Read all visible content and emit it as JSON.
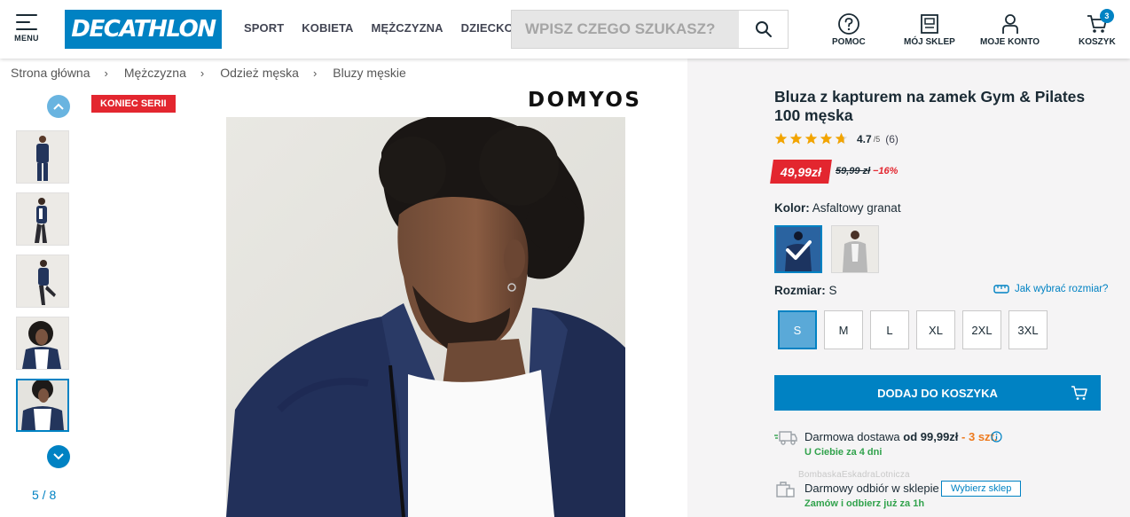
{
  "header": {
    "menu_label": "MENU",
    "logo_text": "DECATHLON",
    "nav": [
      "SPORT",
      "KOBIETA",
      "MĘŻCZYZNA",
      "DZIECKO"
    ],
    "search_placeholder": "WPISZ CZEGO SZUKASZ?",
    "help_label": "POMOC",
    "store_label": "MÓJ SKLEP",
    "account_label": "MOJE KONTO",
    "cart_label": "KOSZYK",
    "cart_count": "3"
  },
  "breadcrumb": [
    "Strona główna",
    "Mężczyzna",
    "Odzież męska",
    "Bluzy męskie"
  ],
  "gallery": {
    "badge": "KONIEC SERII",
    "brand": "DOMYOS",
    "counter": "5 / 8",
    "current_index": 5,
    "total": 8
  },
  "product": {
    "title": "Bluza z kapturem na zamek Gym & Pilates 100 męska",
    "rating": "4.7",
    "rating_max": "/5",
    "review_count": "(6)",
    "stars_filled": 4.7,
    "price": "49,99zł",
    "old_price": "59,99 zł",
    "discount": "−16%",
    "color_label": "Kolor:",
    "color_value": "Asfaltowy granat",
    "size_label": "Rozmiar:",
    "size_value": "S",
    "size_guide": "Jak wybrać rozmiar?",
    "sizes": [
      "S",
      "M",
      "L",
      "XL",
      "2XL",
      "3XL"
    ],
    "selected_size": "S",
    "add_to_cart": "DODAJ DO KOSZYKA"
  },
  "shipping": {
    "free_delivery_prefix": "Darmowa dostawa ",
    "free_delivery_threshold": "od 99,99zł",
    "free_delivery_qty": " - 3 szt.",
    "delivery_eta": "U Ciebie za 4 dni",
    "ghost_text": "BombaskaEskadraLotnicza",
    "pickup_text": "Darmowy odbiór w sklepie",
    "pickup_button": "Wybierz sklep",
    "pickup_eta": "Zamów i odbierz już za 1h"
  },
  "colors": {
    "brand_blue": "#0082c3",
    "sale_red": "#e3262f",
    "green": "#31a24c",
    "orange": "#ee7a1d"
  }
}
